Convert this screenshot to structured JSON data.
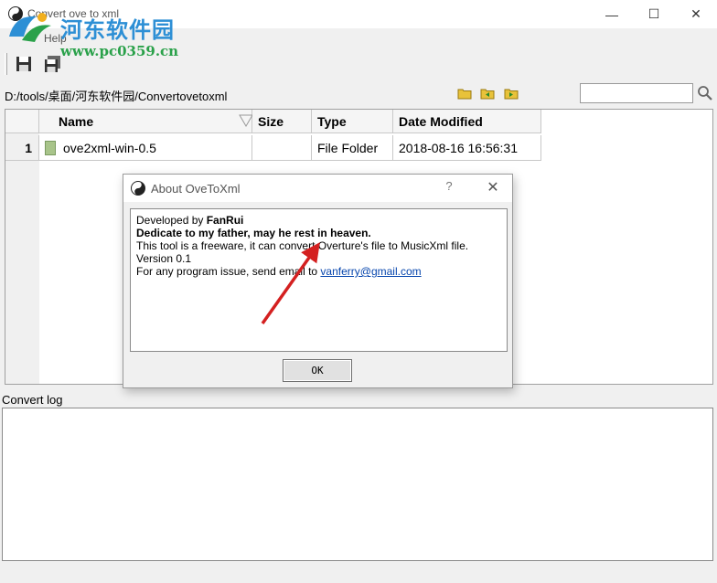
{
  "window": {
    "title": "Convert ove to xml",
    "minimize_glyph": "—",
    "maximize_glyph": "☐",
    "close_glyph": "✕"
  },
  "watermark": {
    "site_name": "河东软件园",
    "url": "www.pc0359.cn"
  },
  "menu": {
    "help": "Help"
  },
  "toolbar": {
    "buttons": [
      "save-icon",
      "save-all-icon"
    ]
  },
  "pathbar": {
    "path": "D:/tools/桌面/河东软件园/Convertovetoxml",
    "folder_buttons": [
      "open-folder-icon",
      "folder-back-icon",
      "folder-forward-icon"
    ],
    "search_value": "",
    "search_icon": "magnifier-icon"
  },
  "filelist": {
    "columns": [
      "Name",
      "Size",
      "Type",
      "Date Modified"
    ],
    "rows": [
      {
        "index": "1",
        "name": "ove2xml-win-0.5",
        "size": "",
        "type": "File Folder",
        "date": "2018-08-16 16:56:31"
      }
    ]
  },
  "log": {
    "label": "Convert log",
    "content": ""
  },
  "dialog": {
    "title": "About OveToXml",
    "help_glyph": "?",
    "close_glyph": "✕",
    "developed_by_prefix": "Developed by ",
    "developer": "FanRui",
    "dedication": "Dedicate to my father, may he rest in heaven.",
    "description": "This tool is a freeware, it can convert Overture's file to MusicXml file.",
    "version": "Version 0.1",
    "issue_prefix": "For any program issue, send email to ",
    "email": "vanferry@gmail.com",
    "ok_label": "OK"
  },
  "colors": {
    "watermark_blue": "#2d8fd5",
    "watermark_green": "#2aa14a",
    "arrow_red": "#d42020",
    "link": "#0645ad"
  }
}
